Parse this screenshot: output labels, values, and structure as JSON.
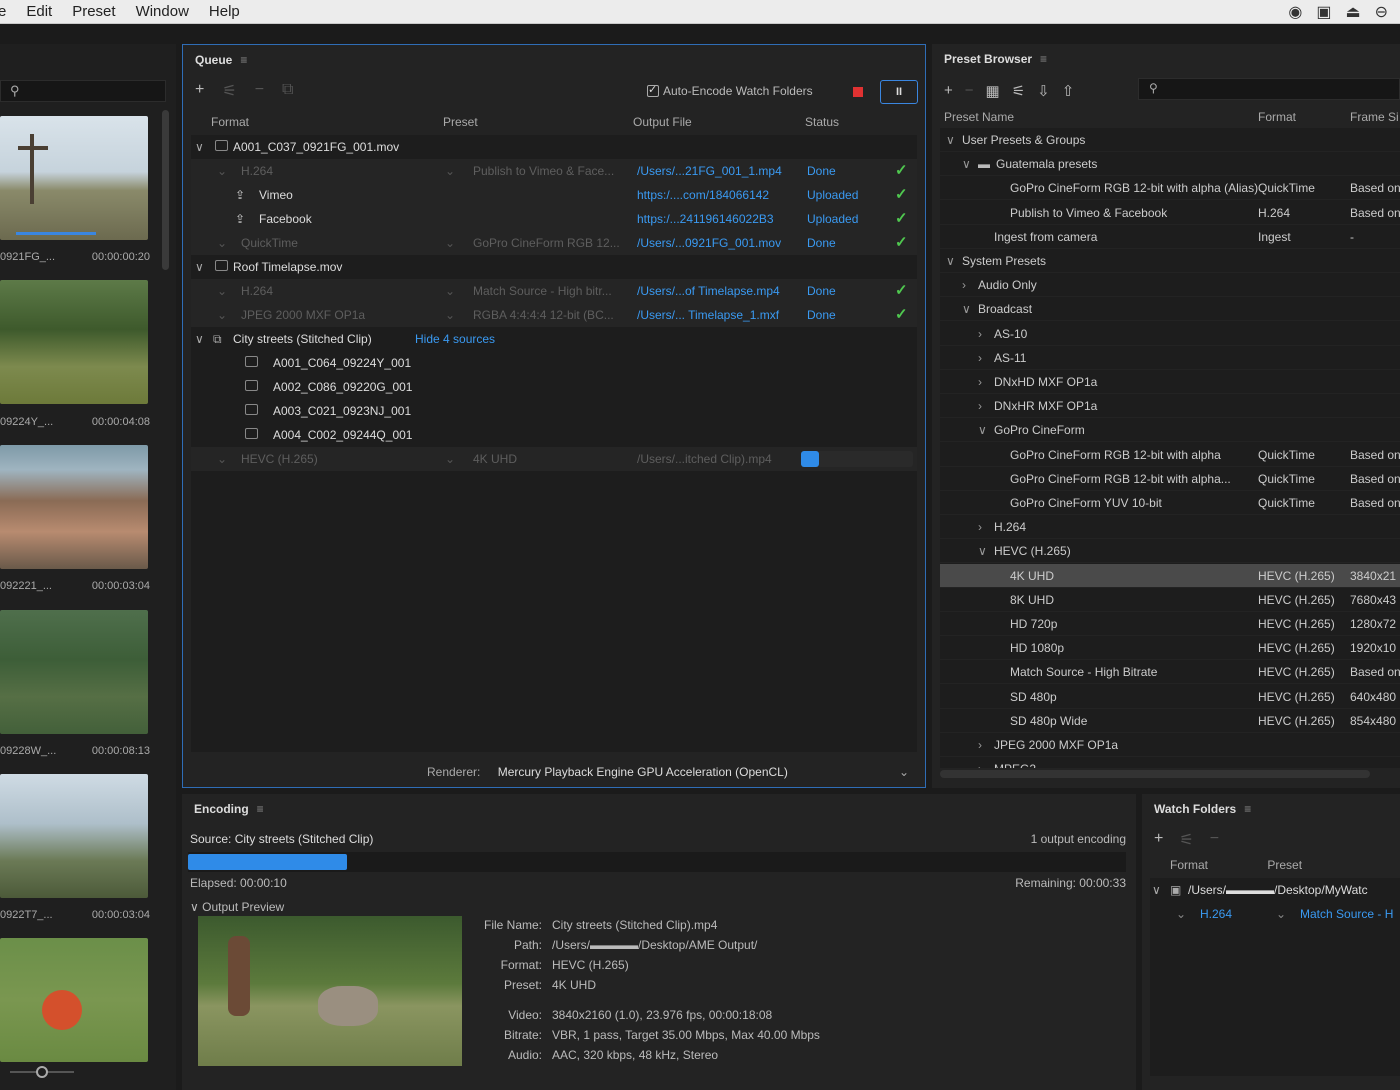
{
  "menubar": {
    "items": [
      "e",
      "Edit",
      "Preset",
      "Window",
      "Help"
    ],
    "tray": [
      "cc-icon",
      "display-icon",
      "airplay-icon",
      "user-icon"
    ]
  },
  "media_browser": {
    "thumbs": [
      {
        "name": "0921FG_...",
        "time": "00:00:00:20"
      },
      {
        "name": "09224Y_...",
        "time": "00:00:04:08"
      },
      {
        "name": "092221_...",
        "time": "00:00:03:04"
      },
      {
        "name": "09228W_...",
        "time": "00:00:08:13"
      },
      {
        "name": "0922T7_...",
        "time": "00:00:03:04"
      }
    ]
  },
  "queue": {
    "title": "Queue",
    "auto_encode_label": "Auto-Encode Watch Folders",
    "pause_label": "II",
    "headers": {
      "format": "Format",
      "preset": "Preset",
      "output": "Output File",
      "status": "Status"
    },
    "rows": [
      {
        "kind": "source",
        "name": "A001_C037_0921FG_001.mov"
      },
      {
        "kind": "output",
        "format": "H.264",
        "preset": "Publish to Vimeo & Face...",
        "output": "/Users/...21FG_001_1.mp4",
        "status": "Done"
      },
      {
        "kind": "publish",
        "name": "Vimeo",
        "output": "https:/....com/184066142",
        "status": "Uploaded"
      },
      {
        "kind": "publish",
        "name": "Facebook",
        "output": "https:/...241196146022B3",
        "status": "Uploaded"
      },
      {
        "kind": "output",
        "format": "QuickTime",
        "preset": "GoPro CineForm RGB 12...",
        "output": "/Users/...0921FG_001.mov",
        "status": "Done"
      },
      {
        "kind": "source",
        "name": "Roof Timelapse.mov"
      },
      {
        "kind": "output",
        "format": "H.264",
        "preset": "Match Source - High bitr...",
        "output": "/Users/...of Timelapse.mp4",
        "status": "Done"
      },
      {
        "kind": "output",
        "format": "JPEG 2000 MXF OP1a",
        "preset": "RGBA 4:4:4:4 12-bit (BC...",
        "output": "/Users/... Timelapse_1.mxf",
        "status": "Done"
      },
      {
        "kind": "stitched",
        "name": "City streets (Stitched Clip)",
        "link": "Hide 4 sources"
      },
      {
        "kind": "clip",
        "name": "A001_C064_09224Y_001"
      },
      {
        "kind": "clip",
        "name": "A002_C086_09220G_001"
      },
      {
        "kind": "clip",
        "name": "A003_C021_0923NJ_001"
      },
      {
        "kind": "clip",
        "name": "A004_C002_09244Q_001"
      },
      {
        "kind": "encoding",
        "format": "HEVC (H.265)",
        "preset": "4K UHD",
        "output": "/Users/...itched Clip).mp4"
      }
    ],
    "renderer_label": "Renderer:",
    "renderer_value": "Mercury Playback Engine GPU Acceleration (OpenCL)"
  },
  "presets": {
    "title": "Preset Browser",
    "headers": {
      "name": "Preset Name",
      "format": "Format",
      "frame": "Frame Si"
    },
    "rows": [
      {
        "ind": 0,
        "tw": "∨",
        "name": "User Presets & Groups",
        "format": "",
        "frame": ""
      },
      {
        "ind": 1,
        "tw": "∨",
        "name": "Guatemala presets",
        "format": "",
        "frame": "",
        "folder": true
      },
      {
        "ind": 3,
        "tw": "",
        "name": "GoPro CineForm RGB 12-bit with alpha (Alias)",
        "format": "QuickTime",
        "frame": "Based on"
      },
      {
        "ind": 3,
        "tw": "",
        "name": "Publish to Vimeo & Facebook",
        "format": "H.264",
        "frame": "Based on"
      },
      {
        "ind": 2,
        "tw": "",
        "name": "Ingest from camera",
        "format": "Ingest",
        "frame": "-"
      },
      {
        "ind": 0,
        "tw": "∨",
        "name": "System Presets",
        "format": "",
        "frame": ""
      },
      {
        "ind": 1,
        "tw": "›",
        "name": "Audio Only",
        "format": "",
        "frame": ""
      },
      {
        "ind": 1,
        "tw": "∨",
        "name": "Broadcast",
        "format": "",
        "frame": ""
      },
      {
        "ind": 2,
        "tw": "›",
        "name": "AS-10",
        "format": "",
        "frame": ""
      },
      {
        "ind": 2,
        "tw": "›",
        "name": "AS-11",
        "format": "",
        "frame": ""
      },
      {
        "ind": 2,
        "tw": "›",
        "name": "DNxHD MXF OP1a",
        "format": "",
        "frame": ""
      },
      {
        "ind": 2,
        "tw": "›",
        "name": "DNxHR MXF OP1a",
        "format": "",
        "frame": ""
      },
      {
        "ind": 2,
        "tw": "∨",
        "name": "GoPro CineForm",
        "format": "",
        "frame": ""
      },
      {
        "ind": 3,
        "tw": "",
        "name": "GoPro CineForm RGB 12-bit with alpha",
        "format": "QuickTime",
        "frame": "Based on"
      },
      {
        "ind": 3,
        "tw": "",
        "name": "GoPro CineForm RGB 12-bit with alpha...",
        "format": "QuickTime",
        "frame": "Based on"
      },
      {
        "ind": 3,
        "tw": "",
        "name": "GoPro CineForm YUV 10-bit",
        "format": "QuickTime",
        "frame": "Based on"
      },
      {
        "ind": 2,
        "tw": "›",
        "name": "H.264",
        "format": "",
        "frame": ""
      },
      {
        "ind": 2,
        "tw": "∨",
        "name": "HEVC (H.265)",
        "format": "",
        "frame": ""
      },
      {
        "ind": 3,
        "tw": "",
        "name": "4K UHD",
        "format": "HEVC (H.265)",
        "frame": "3840x21",
        "sel": true
      },
      {
        "ind": 3,
        "tw": "",
        "name": "8K UHD",
        "format": "HEVC (H.265)",
        "frame": "7680x43"
      },
      {
        "ind": 3,
        "tw": "",
        "name": "HD 720p",
        "format": "HEVC (H.265)",
        "frame": "1280x72"
      },
      {
        "ind": 3,
        "tw": "",
        "name": "HD 1080p",
        "format": "HEVC (H.265)",
        "frame": "1920x10"
      },
      {
        "ind": 3,
        "tw": "",
        "name": "Match Source - High Bitrate",
        "format": "HEVC (H.265)",
        "frame": "Based on"
      },
      {
        "ind": 3,
        "tw": "",
        "name": "SD 480p",
        "format": "HEVC (H.265)",
        "frame": "640x480"
      },
      {
        "ind": 3,
        "tw": "",
        "name": "SD 480p Wide",
        "format": "HEVC (H.265)",
        "frame": "854x480"
      },
      {
        "ind": 2,
        "tw": "›",
        "name": "JPEG 2000 MXF OP1a",
        "format": "",
        "frame": ""
      },
      {
        "ind": 2,
        "tw": "›",
        "name": "MPEG2",
        "format": "",
        "frame": ""
      }
    ]
  },
  "encoding": {
    "title": "Encoding",
    "source": "Source: City streets (Stitched Clip)",
    "count": "1 output encoding",
    "progress": 0.17,
    "elapsed": "Elapsed: 00:00:10",
    "remaining": "Remaining: 00:00:33",
    "preview_label": "Output Preview",
    "details": [
      {
        "k": "File Name:",
        "v": "City streets (Stitched Clip).mp4"
      },
      {
        "k": "Path:",
        "v": "/Users/▬▬▬▬/Desktop/AME Output/"
      },
      {
        "k": "Format:",
        "v": "HEVC (H.265)"
      },
      {
        "k": "Preset:",
        "v": "4K UHD"
      },
      {
        "k": "Video:",
        "v": "3840x2160 (1.0), 23.976 fps, 00:00:18:08"
      },
      {
        "k": "Bitrate:",
        "v": "VBR, 1 pass, Target 35.00 Mbps, Max 40.00 Mbps"
      },
      {
        "k": "Audio:",
        "v": "AAC, 320 kbps, 48 kHz, Stereo"
      }
    ]
  },
  "watch": {
    "title": "Watch Folders",
    "format_header": "Format",
    "preset_header": "Preset",
    "folder": "/Users/▬▬▬▬/Desktop/MyWatc",
    "fmt": "H.264",
    "preset": "Match Source - H"
  }
}
